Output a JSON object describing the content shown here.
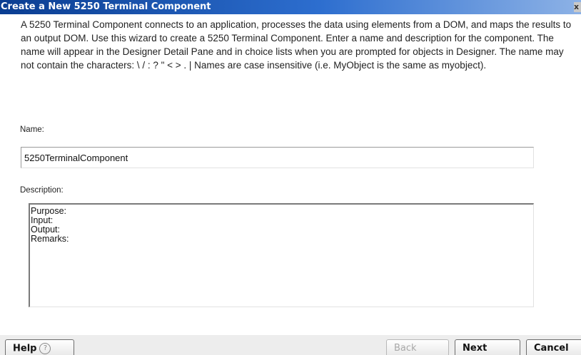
{
  "window": {
    "title": "Create a New 5250 Terminal Component",
    "close_glyph": "x"
  },
  "intro": {
    "text": "A 5250 Terminal Component connects to an application, processes the data using elements from a DOM, and maps the results to an output DOM.  Use this wizard to create a 5250 Terminal Component.  Enter a name and description for the component.  The name will appear in the Designer Detail Pane and in choice lists when you are prompted for objects in Designer.  The name may not contain the characters: \\ / : ? \" < > . | Names are case insensitive (i.e. MyObject is the same as myobject)."
  },
  "form": {
    "name_label": "Name:",
    "name_value": "5250TerminalComponent",
    "description_label": "Description:",
    "description_value": "Purpose:\nInput:\nOutput:\nRemarks:"
  },
  "buttons": {
    "help_label": "Help",
    "help_icon": "?",
    "back_label": "Back",
    "next_label": "Next",
    "cancel_label": "Cancel"
  },
  "colors": {
    "titlebar_start": "#0a3d91",
    "titlebar_end": "#8db2e6",
    "content_bg": "#ffffff",
    "chrome_bg": "#ededed"
  }
}
